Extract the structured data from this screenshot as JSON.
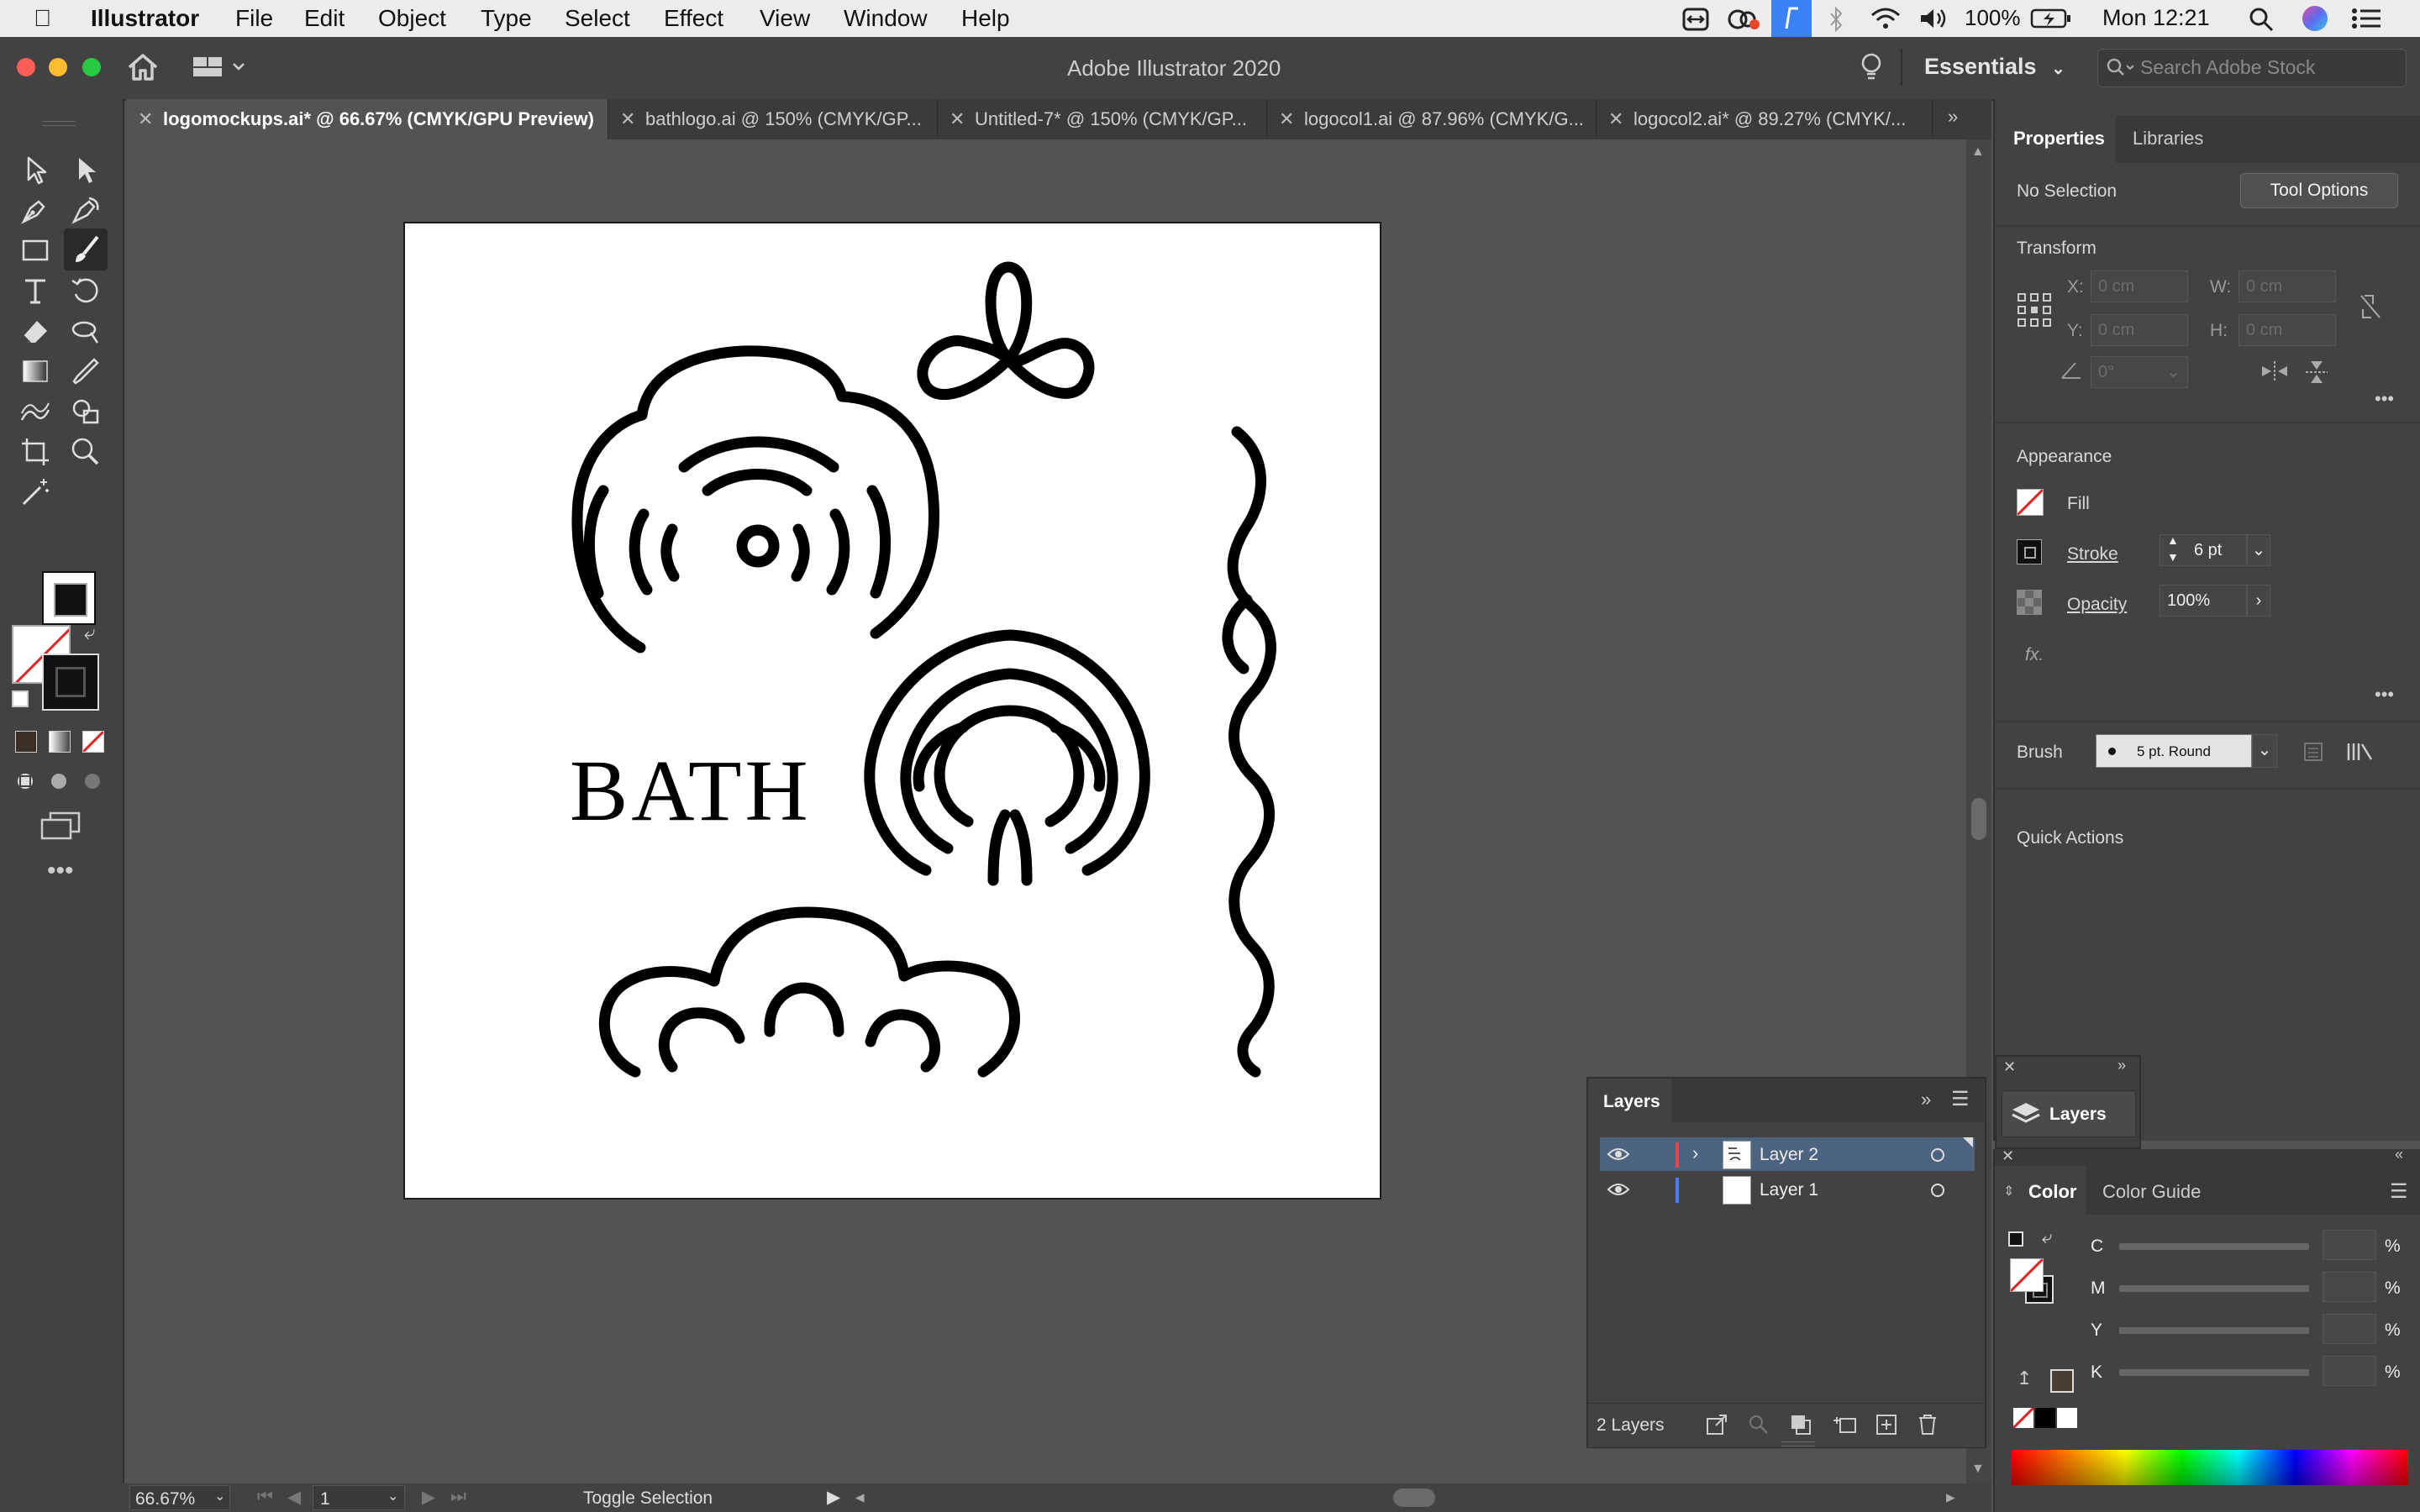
{
  "menubar": {
    "apple": "",
    "app": "Illustrator",
    "items": [
      "File",
      "Edit",
      "Object",
      "Type",
      "Select",
      "Effect",
      "View",
      "Window",
      "Help"
    ],
    "battery": "100%",
    "clock": "Mon 12:21"
  },
  "titlebar": {
    "title": "Adobe Illustrator 2020",
    "workspace": "Essentials",
    "search_placeholder": "Search Adobe Stock"
  },
  "tabs": [
    {
      "label": "logomockups.ai* @ 66.67% (CMYK/GPU Preview)",
      "active": true
    },
    {
      "label": "bathlogo.ai @ 150% (CMYK/GP...",
      "active": false
    },
    {
      "label": "Untitled-7* @ 150% (CMYK/GP...",
      "active": false
    },
    {
      "label": "logocol1.ai @ 87.96% (CMYK/G...",
      "active": false
    },
    {
      "label": "logocol2.ai* @ 89.27% (CMYK/...",
      "active": false
    }
  ],
  "artboard": {
    "wordmark": "BATH"
  },
  "statusbar": {
    "zoom": "66.67%",
    "artboard_num": "1",
    "status": "Toggle Selection"
  },
  "properties": {
    "tabs": [
      "Properties",
      "Libraries"
    ],
    "selection": "No Selection",
    "tool_options": "Tool Options",
    "transform": {
      "title": "Transform",
      "x_label": "X:",
      "x": "0 cm",
      "y_label": "Y:",
      "y": "0 cm",
      "w_label": "W:",
      "w": "0 cm",
      "h_label": "H:",
      "h": "0 cm",
      "angle": "0°"
    },
    "appearance": {
      "title": "Appearance",
      "fill": "Fill",
      "stroke": "Stroke",
      "stroke_weight": "6 pt",
      "opacity_label": "Opacity",
      "opacity": "100%",
      "fx": "fx."
    },
    "brush": {
      "label": "Brush",
      "value": "5 pt. Round"
    },
    "quick_actions": "Quick Actions"
  },
  "layers": {
    "title": "Layers",
    "rows": [
      {
        "name": "Layer 2",
        "color": "#e8464d",
        "selected": true
      },
      {
        "name": "Layer 1",
        "color": "#4a7cf0",
        "selected": false
      }
    ],
    "count": "2 Layers",
    "dock_label": "Layers"
  },
  "color_panel": {
    "tabs": [
      "Color",
      "Color Guide"
    ],
    "channels": [
      "C",
      "M",
      "Y",
      "K"
    ],
    "pct": "%"
  }
}
